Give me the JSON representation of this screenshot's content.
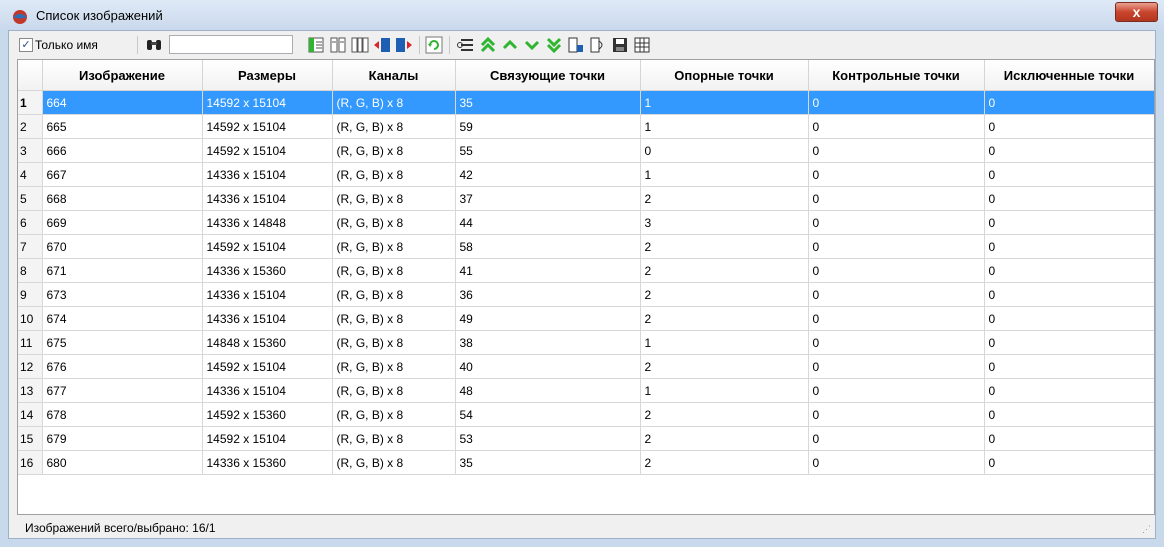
{
  "window": {
    "title": "Список изображений",
    "close_label": "x"
  },
  "toolbar": {
    "only_name_checked": "✓",
    "only_name_label": "Только имя",
    "search_value": "",
    "icons": [
      {
        "name": "binoculars-icon"
      },
      {
        "name": "columns-left-icon"
      },
      {
        "name": "columns-icon"
      },
      {
        "name": "columns-grid-icon"
      },
      {
        "name": "move-column-left-icon"
      },
      {
        "name": "move-column-right-icon"
      },
      {
        "name": "refresh-icon"
      },
      {
        "name": "list-settings-icon"
      },
      {
        "name": "move-top-icon"
      },
      {
        "name": "move-up-icon"
      },
      {
        "name": "move-down-icon"
      },
      {
        "name": "move-bottom-icon"
      },
      {
        "name": "import-icon"
      },
      {
        "name": "export-icon"
      },
      {
        "name": "save-icon"
      },
      {
        "name": "table-icon"
      }
    ],
    "colors": {
      "green": "#2fb52f",
      "red": "#d8262c",
      "blue": "#1e5fb4"
    }
  },
  "table": {
    "columns": [
      "Изображение",
      "Размеры",
      "Каналы",
      "Связующие точки",
      "Опорные точки",
      "Контрольные точки",
      "Исключенные точки"
    ],
    "rows": [
      {
        "n": "1",
        "image": "664",
        "size": "14592 x 15104",
        "channels": "(R, G, B) x 8",
        "tie": "35",
        "gcp": "1",
        "check": "0",
        "excluded": "0"
      },
      {
        "n": "2",
        "image": "665",
        "size": "14592 x 15104",
        "channels": "(R, G, B) x 8",
        "tie": "59",
        "gcp": "1",
        "check": "0",
        "excluded": "0"
      },
      {
        "n": "3",
        "image": "666",
        "size": "14592 x 15104",
        "channels": "(R, G, B) x 8",
        "tie": "55",
        "gcp": "0",
        "check": "0",
        "excluded": "0"
      },
      {
        "n": "4",
        "image": "667",
        "size": "14336 x 15104",
        "channels": "(R, G, B) x 8",
        "tie": "42",
        "gcp": "1",
        "check": "0",
        "excluded": "0"
      },
      {
        "n": "5",
        "image": "668",
        "size": "14336 x 15104",
        "channels": "(R, G, B) x 8",
        "tie": "37",
        "gcp": "2",
        "check": "0",
        "excluded": "0"
      },
      {
        "n": "6",
        "image": "669",
        "size": "14336 x 14848",
        "channels": "(R, G, B) x 8",
        "tie": "44",
        "gcp": "3",
        "check": "0",
        "excluded": "0"
      },
      {
        "n": "7",
        "image": "670",
        "size": "14592 x 15104",
        "channels": "(R, G, B) x 8",
        "tie": "58",
        "gcp": "2",
        "check": "0",
        "excluded": "0"
      },
      {
        "n": "8",
        "image": "671",
        "size": "14336 x 15360",
        "channels": "(R, G, B) x 8",
        "tie": "41",
        "gcp": "2",
        "check": "0",
        "excluded": "0"
      },
      {
        "n": "9",
        "image": "673",
        "size": "14336 x 15104",
        "channels": "(R, G, B) x 8",
        "tie": "36",
        "gcp": "2",
        "check": "0",
        "excluded": "0"
      },
      {
        "n": "10",
        "image": "674",
        "size": "14336 x 15104",
        "channels": "(R, G, B) x 8",
        "tie": "49",
        "gcp": "2",
        "check": "0",
        "excluded": "0"
      },
      {
        "n": "11",
        "image": "675",
        "size": "14848 x 15360",
        "channels": "(R, G, B) x 8",
        "tie": "38",
        "gcp": "1",
        "check": "0",
        "excluded": "0"
      },
      {
        "n": "12",
        "image": "676",
        "size": "14592 x 15104",
        "channels": "(R, G, B) x 8",
        "tie": "40",
        "gcp": "2",
        "check": "0",
        "excluded": "0"
      },
      {
        "n": "13",
        "image": "677",
        "size": "14336 x 15104",
        "channels": "(R, G, B) x 8",
        "tie": "48",
        "gcp": "1",
        "check": "0",
        "excluded": "0"
      },
      {
        "n": "14",
        "image": "678",
        "size": "14592 x 15360",
        "channels": "(R, G, B) x 8",
        "tie": "54",
        "gcp": "2",
        "check": "0",
        "excluded": "0"
      },
      {
        "n": "15",
        "image": "679",
        "size": "14592 x 15104",
        "channels": "(R, G, B) x 8",
        "tie": "53",
        "gcp": "2",
        "check": "0",
        "excluded": "0"
      },
      {
        "n": "16",
        "image": "680",
        "size": "14336 x 15360",
        "channels": "(R, G, B) x 8",
        "tie": "35",
        "gcp": "2",
        "check": "0",
        "excluded": "0"
      }
    ],
    "selected_row": 0
  },
  "status": {
    "text": "Изображений всего/выбрано: 16/1"
  }
}
